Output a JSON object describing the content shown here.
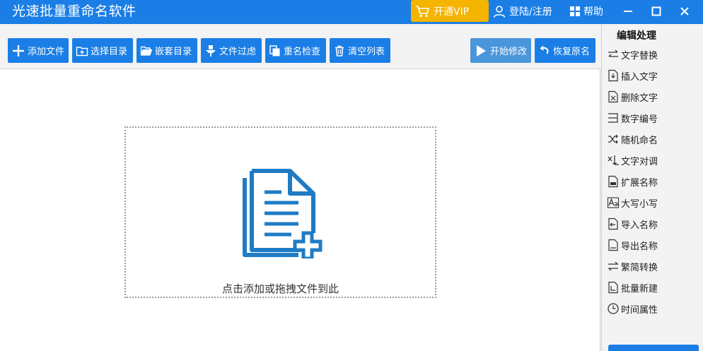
{
  "app": {
    "title": "光速批量重命名软件",
    "accent_color": "#1a7ee6",
    "vip_color": "#f4b400"
  },
  "titlebar": {
    "vip_label": "开通VIP",
    "vip_icon": "cart-icon",
    "login_label": "登陆/注册",
    "login_icon": "user-icon",
    "help_label": "帮助",
    "help_icon": "grid-icon",
    "window_controls": [
      "minimize-icon",
      "maximize-icon",
      "close-icon"
    ]
  },
  "toolbar": {
    "buttons": [
      {
        "label": "添加文件",
        "icon": "plus-icon"
      },
      {
        "label": "选择目录",
        "icon": "folder-add-icon"
      },
      {
        "label": "嵌套目录",
        "icon": "folder-open-icon"
      },
      {
        "label": "文件过虑",
        "icon": "filter-icon"
      },
      {
        "label": "重名检查",
        "icon": "copy-icon"
      },
      {
        "label": "清空列表",
        "icon": "trash-icon"
      }
    ],
    "start_label": "开始修改",
    "start_icon": "play-icon",
    "restore_label": "恢复原名",
    "restore_icon": "undo-icon"
  },
  "dropzone": {
    "text": "点击添加或拖拽文件到此",
    "icon": "file-add-icon"
  },
  "side": {
    "title": "编辑处理",
    "items": [
      {
        "label": "文字替换",
        "icon": "swap-icon"
      },
      {
        "label": "插入文字",
        "icon": "insert-text-icon"
      },
      {
        "label": "删除文字",
        "icon": "delete-text-icon"
      },
      {
        "label": "数字编号",
        "icon": "number-icon"
      },
      {
        "label": "随机命名",
        "icon": "shuffle-icon"
      },
      {
        "label": "文字对调",
        "icon": "exchange-icon"
      },
      {
        "label": "扩展名称",
        "icon": "extension-icon"
      },
      {
        "label": "大写小写",
        "icon": "case-icon"
      },
      {
        "label": "导入名称",
        "icon": "import-icon"
      },
      {
        "label": "导出名称",
        "icon": "export-icon"
      },
      {
        "label": "繁简转换",
        "icon": "convert-icon"
      },
      {
        "label": "批量新建",
        "icon": "new-file-icon"
      },
      {
        "label": "时间属性",
        "icon": "clock-icon"
      }
    ]
  }
}
